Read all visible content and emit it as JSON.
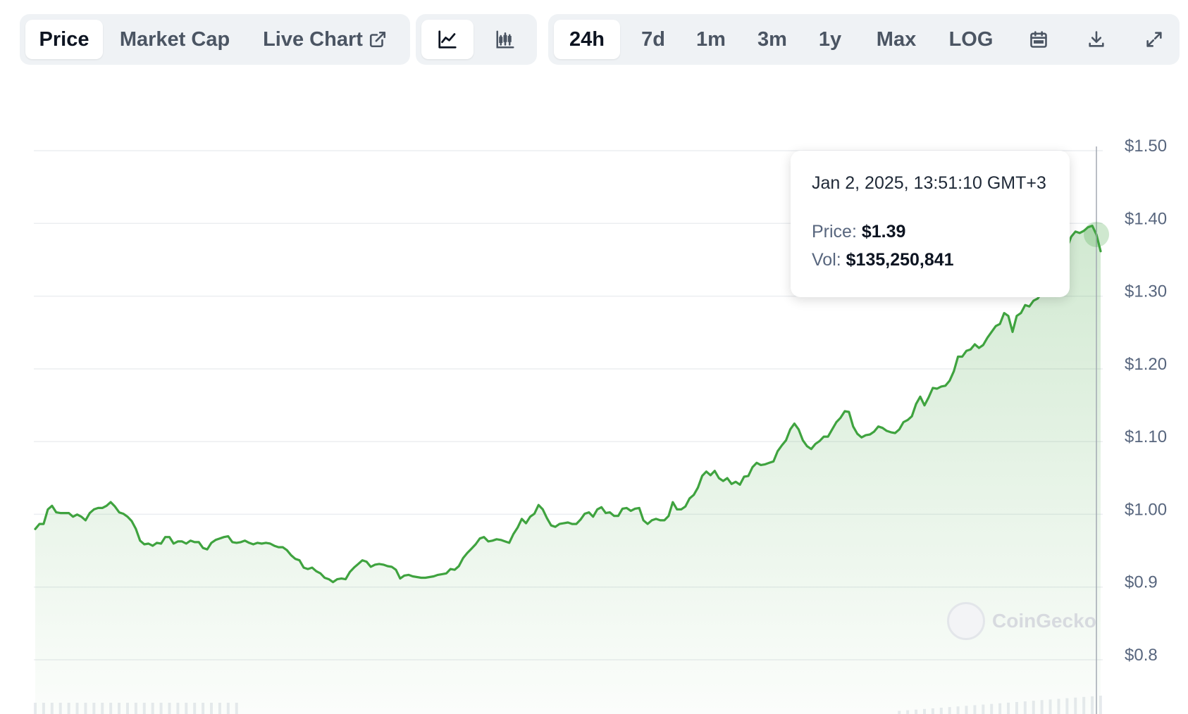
{
  "tabs": [
    {
      "label": "Price",
      "active": true
    },
    {
      "label": "Market Cap",
      "active": false
    },
    {
      "label": "Live Chart",
      "active": false,
      "icon": "external-link-icon"
    }
  ],
  "chart_type_buttons": [
    {
      "icon": "line-chart-icon",
      "active": true
    },
    {
      "icon": "candlestick-icon",
      "active": false
    }
  ],
  "ranges": [
    {
      "label": "24h",
      "active": true
    },
    {
      "label": "7d",
      "active": false
    },
    {
      "label": "1m",
      "active": false
    },
    {
      "label": "3m",
      "active": false
    },
    {
      "label": "1y",
      "active": false
    },
    {
      "label": "Max",
      "active": false
    },
    {
      "label": "LOG",
      "active": false
    }
  ],
  "tool_icons": [
    "calendar-icon",
    "download-icon",
    "fullscreen-icon"
  ],
  "tooltip": {
    "date": "Jan 2, 2025, 13:51:10 GMT+3",
    "price_label": "Price:",
    "price_value": "$1.39",
    "vol_label": "Vol:",
    "vol_value": "$135,250,841"
  },
  "watermark": "CoinGecko",
  "colors": {
    "line": "#3fa33f",
    "area": "#3fa33f",
    "active_text": "#0d1421"
  },
  "chart_data": {
    "type": "area",
    "title": "",
    "xlabel": "",
    "ylabel": "",
    "ylim": [
      0.78,
      1.51
    ],
    "y_ticks": [
      1.5,
      1.4,
      1.3,
      1.2,
      1.1,
      1.0,
      0.9,
      0.8
    ],
    "y_tick_labels": [
      "$1.50",
      "$1.40",
      "$1.30",
      "$1.20",
      "$1.10",
      "$1.00",
      "$0.9",
      "$0.8"
    ],
    "grid": true,
    "hover_index": 253,
    "values": [
      0.973,
      0.98,
      0.98,
      1.0,
      1.005,
      0.996,
      0.995,
      0.995,
      0.995,
      0.99,
      0.993,
      0.99,
      0.985,
      0.995,
      1.0,
      1.002,
      1.002,
      1.005,
      1.01,
      1.004,
      0.996,
      0.994,
      0.99,
      0.984,
      0.973,
      0.957,
      0.952,
      0.953,
      0.95,
      0.954,
      0.953,
      0.962,
      0.962,
      0.953,
      0.956,
      0.956,
      0.953,
      0.957,
      0.955,
      0.955,
      0.947,
      0.945,
      0.954,
      0.958,
      0.96,
      0.962,
      0.963,
      0.955,
      0.954,
      0.955,
      0.957,
      0.954,
      0.952,
      0.954,
      0.953,
      0.954,
      0.953,
      0.95,
      0.948,
      0.948,
      0.944,
      0.937,
      0.932,
      0.93,
      0.92,
      0.918,
      0.92,
      0.915,
      0.912,
      0.906,
      0.904,
      0.9,
      0.904,
      0.905,
      0.904,
      0.914,
      0.92,
      0.925,
      0.93,
      0.928,
      0.921,
      0.924,
      0.925,
      0.924,
      0.922,
      0.921,
      0.917,
      0.905,
      0.909,
      0.91,
      0.908,
      0.907,
      0.906,
      0.906,
      0.907,
      0.908,
      0.91,
      0.911,
      0.912,
      0.918,
      0.917,
      0.922,
      0.933,
      0.94,
      0.946,
      0.952,
      0.96,
      0.962,
      0.956,
      0.957,
      0.959,
      0.958,
      0.956,
      0.954,
      0.966,
      0.975,
      0.987,
      0.981,
      0.99,
      0.994,
      1.006,
      1.0,
      0.988,
      0.978,
      0.976,
      0.98,
      0.981,
      0.982,
      0.98,
      0.98,
      0.986,
      0.994,
      0.996,
      0.99,
      1.0,
      1.003,
      0.995,
      0.996,
      0.991,
      0.991,
      1.001,
      1.002,
      0.998,
      1.001,
      1.002,
      0.985,
      0.98,
      0.985,
      0.987,
      0.985,
      0.985,
      0.991,
      1.01,
      1.0,
      1.0,
      1.004,
      1.015,
      1.02,
      1.03,
      1.046,
      1.052,
      1.047,
      1.053,
      1.043,
      1.039,
      1.043,
      1.035,
      1.038,
      1.034,
      1.045,
      1.046,
      1.058,
      1.064,
      1.061,
      1.062,
      1.064,
      1.066,
      1.08,
      1.088,
      1.095,
      1.11,
      1.118,
      1.11,
      1.095,
      1.087,
      1.083,
      1.09,
      1.094,
      1.1,
      1.1,
      1.11,
      1.12,
      1.126,
      1.135,
      1.134,
      1.114,
      1.104,
      1.099,
      1.102,
      1.103,
      1.107,
      1.114,
      1.112,
      1.108,
      1.106,
      1.105,
      1.11,
      1.12,
      1.123,
      1.128,
      1.145,
      1.155,
      1.143,
      1.154,
      1.167,
      1.166,
      1.169,
      1.17,
      1.177,
      1.19,
      1.21,
      1.21,
      1.218,
      1.22,
      1.227,
      1.222,
      1.226,
      1.236,
      1.244,
      1.252,
      1.255,
      1.27,
      1.266,
      1.244,
      1.266,
      1.27,
      1.281,
      1.279,
      1.287,
      1.29,
      1.298,
      1.305,
      1.31,
      1.318,
      1.33,
      1.35,
      1.36,
      1.375,
      1.382,
      1.38,
      1.383,
      1.388,
      1.39,
      1.378,
      1.355
    ]
  }
}
